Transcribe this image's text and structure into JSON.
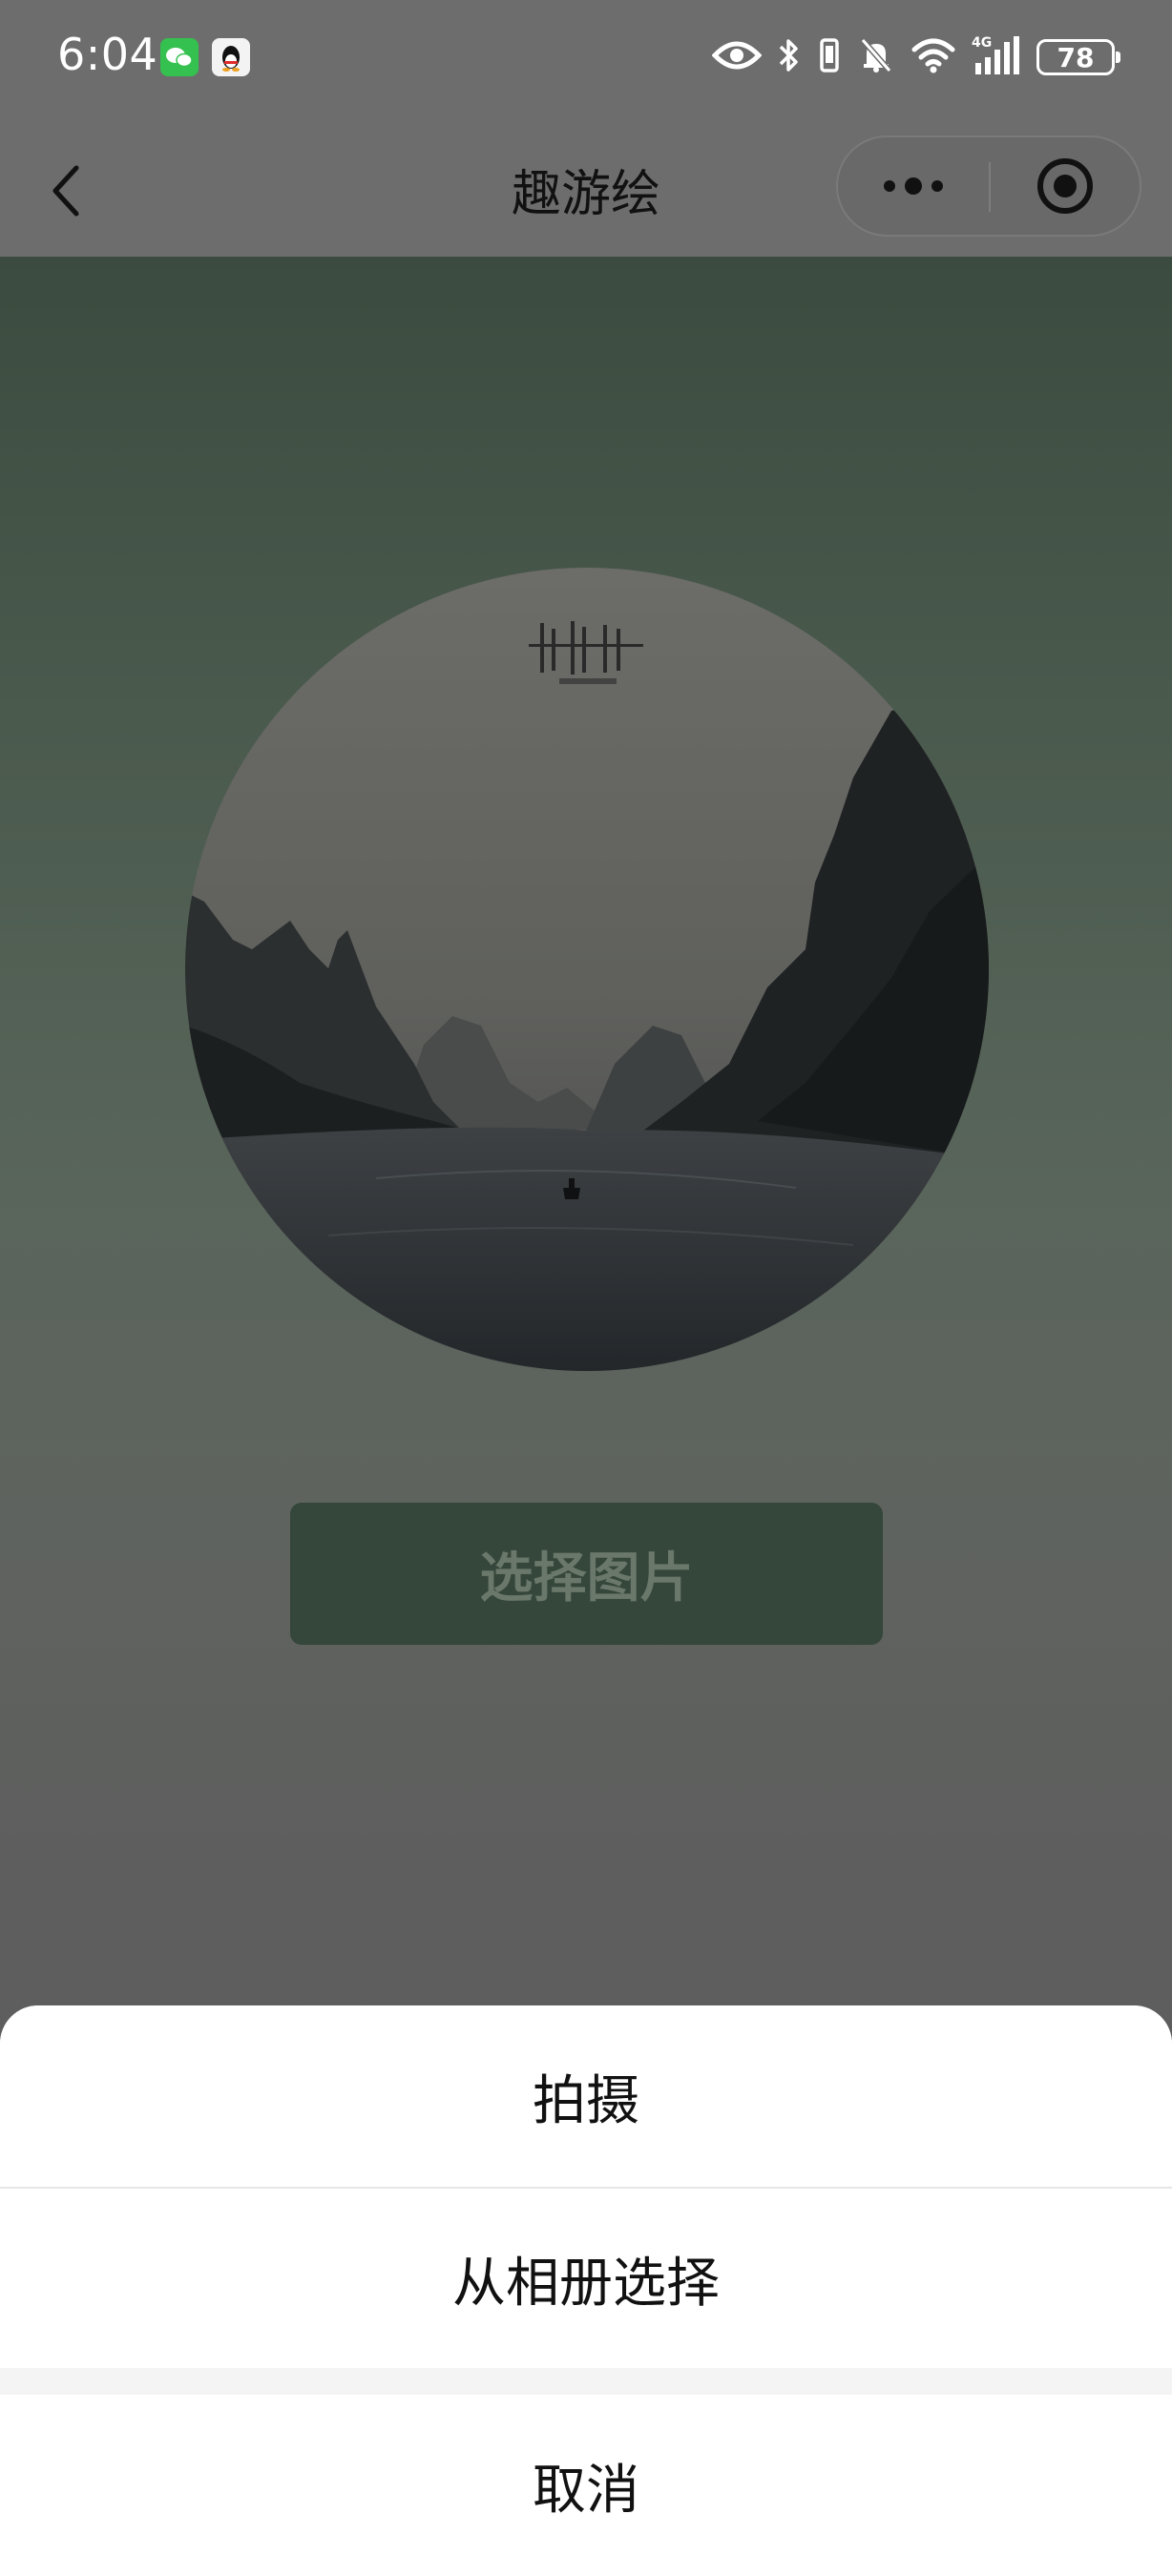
{
  "status_bar": {
    "time": "6:04",
    "network": "4G",
    "battery": "78",
    "icons": [
      "wechat-notification-icon",
      "qq-notification-icon",
      "eye-icon",
      "bluetooth-icon",
      "vibrate-icon",
      "mute-bell-icon",
      "wifi-icon",
      "cellular-signal-icon",
      "battery-icon"
    ]
  },
  "nav": {
    "title": "趣游绘",
    "back_icon": "chevron-left-icon",
    "more_icon": "more-dots-icon",
    "close_icon": "target-close-icon"
  },
  "main": {
    "select_button": "选择图片",
    "image": "landscape-photo"
  },
  "action_sheet": {
    "items": [
      {
        "label": "拍摄"
      },
      {
        "label": "从相册选择"
      }
    ],
    "cancel": "取消"
  },
  "colors": {
    "overlay": "#5b5b5b",
    "content_top": "#3b4b3f",
    "button_bg": "#35463a",
    "sheet_bg": "#ffffff"
  }
}
